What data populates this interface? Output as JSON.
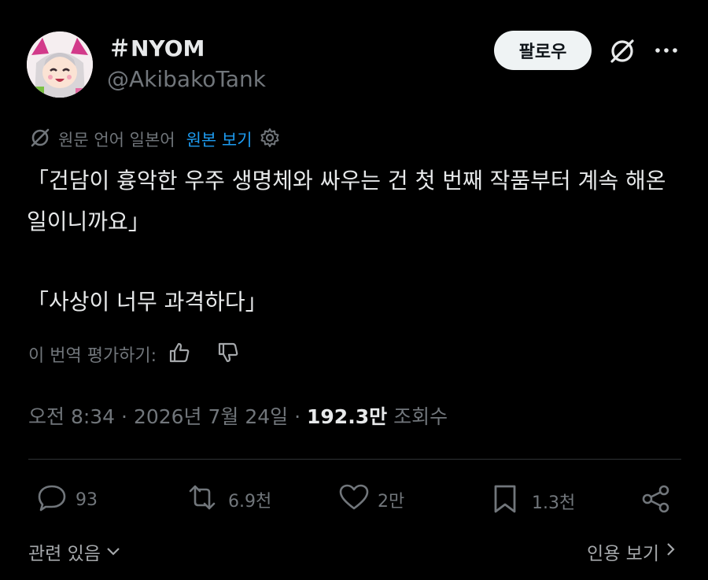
{
  "author": {
    "display_name": "＃NYOM",
    "handle": "@AkibakoTank",
    "avatar_icon": "anime-character-avatar"
  },
  "header": {
    "follow_label": "팔로우",
    "grok_icon": "grok-icon",
    "more_icon": "more-dots-icon"
  },
  "translation": {
    "source_label": "원문 언어 일본어",
    "show_original_label": "원본 보기",
    "settings_icon": "gear-icon"
  },
  "tweet": {
    "lines": [
      "「건담이 흉악한 우주 생명체와 싸우는 건 첫 번째 작품부터 계속 해온 일이니까요」",
      "「사상이 너무 과격하다」"
    ]
  },
  "rating": {
    "label": "이 번역 평가하기:",
    "thumbs_up_icon": "thumbs-up-icon",
    "thumbs_down_icon": "thumbs-down-icon"
  },
  "meta": {
    "time": "오전 8:34",
    "separator": " · ",
    "date": "2026년 7월 24일",
    "views_count": "192.3만",
    "views_label": "조회수"
  },
  "actions": {
    "replies": "93",
    "reposts": "6.9천",
    "likes": "2만",
    "bookmarks": "1.3천"
  },
  "footer": {
    "related_label": "관련 있음",
    "quotes_label": "인용 보기"
  },
  "colors": {
    "background": "#000000",
    "text": "#e7e9ea",
    "muted": "#71767b",
    "link": "#1d9bf0"
  }
}
